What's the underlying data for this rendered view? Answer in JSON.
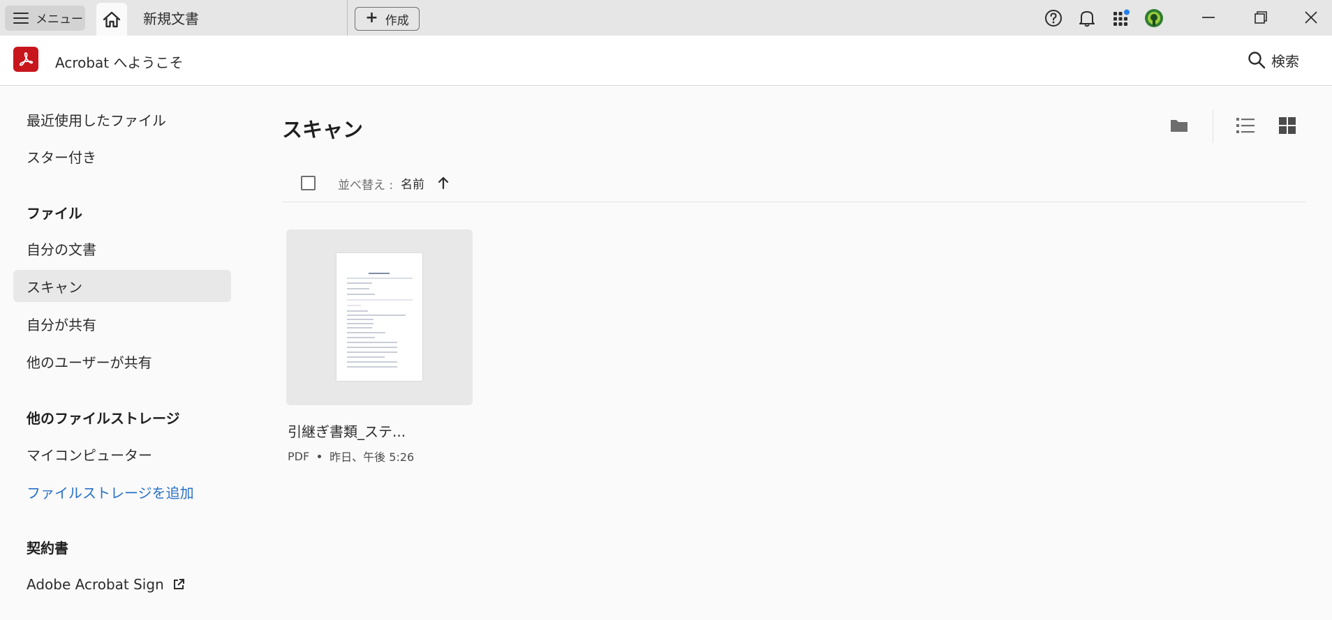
{
  "titlebar": {
    "menu_label": "メニュー",
    "doc_tab_label": "新規文書",
    "create_label": "作成",
    "badge_color": "#2680eb"
  },
  "header": {
    "app_title": "Acrobat へようこそ",
    "search_label": "検索",
    "brand_color": "#c8161d"
  },
  "sidebar": {
    "recent": "最近使用したファイル",
    "starred": "スター付き",
    "files_heading": "ファイル",
    "my_documents": "自分の文書",
    "scans": "スキャン",
    "shared_by_me": "自分が共有",
    "shared_by_others": "他のユーザーが共有",
    "other_storage_heading": "他のファイルストレージ",
    "my_computer": "マイコンピューター",
    "add_storage": "ファイルストレージを追加",
    "contracts_heading": "契約書",
    "acrobat_sign": "Adobe Acrobat Sign",
    "link_color": "#2870c8"
  },
  "main": {
    "title": "スキャン",
    "sort_label": "並べ替え :",
    "sort_value": "名前",
    "files": [
      {
        "name": "引継ぎ書類_ステ...",
        "type": "PDF",
        "date": "昨日、午後 5:26"
      }
    ]
  }
}
